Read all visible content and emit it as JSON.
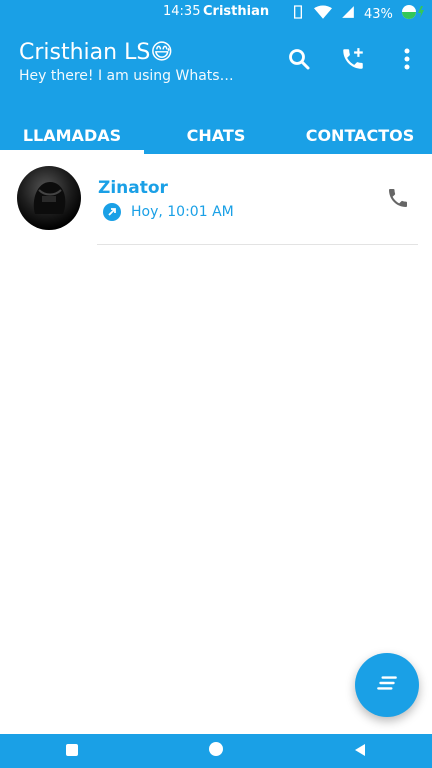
{
  "status_bar": {
    "time": "14:35",
    "carrier": "Cristhian",
    "battery": "43%"
  },
  "header": {
    "title": "Cristhian LS😅",
    "subtitle": "Hey there! I am using Whats…"
  },
  "tabs": [
    {
      "label": "LLAMADAS"
    },
    {
      "label": "CHATS"
    },
    {
      "label": "CONTACTOS"
    }
  ],
  "calls": [
    {
      "name": "Zinator",
      "time": "Hoy, 10:01 AM"
    }
  ],
  "colors": {
    "accent": "#1aa0e6"
  },
  "icons": {
    "search": "search-icon",
    "add_call": "add-call-icon",
    "more": "more-vert-icon",
    "phone": "phone-icon",
    "fab": "chat-lines-icon"
  }
}
